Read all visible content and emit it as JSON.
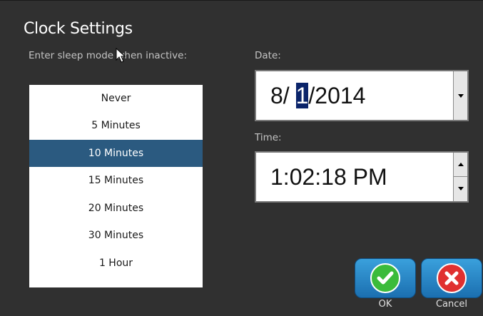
{
  "dialog": {
    "title": "Clock Settings"
  },
  "sleep": {
    "label": "Enter sleep mode when inactive:",
    "options": [
      "Never",
      "5 Minutes",
      "10 Minutes",
      "15 Minutes",
      "20 Minutes",
      "30 Minutes",
      "1 Hour"
    ],
    "selected": "10 Minutes"
  },
  "date": {
    "label": "Date:",
    "month": "8/",
    "day": "1",
    "year": "/2014"
  },
  "time": {
    "label": "Time:",
    "value": "1:02:18 PM"
  },
  "buttons": {
    "ok_label": "OK",
    "cancel_label": "Cancel"
  },
  "colors": {
    "background": "#303030",
    "selected_item": "#2b5a80",
    "button_blue": "#1b6fb0",
    "ok_icon": "#3bbb3b",
    "cancel_icon": "#e03030"
  },
  "icons": {
    "ok": "check-icon",
    "cancel": "x-icon",
    "date_dropdown": "chevron-down-icon",
    "time_up": "spin-up-icon",
    "time_down": "spin-down-icon"
  }
}
